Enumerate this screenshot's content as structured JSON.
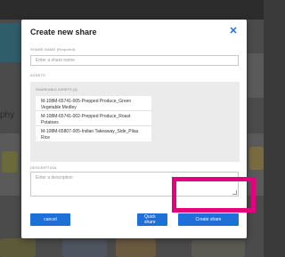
{
  "modal": {
    "title": "Create new share",
    "close_icon": "close-icon",
    "share_name_label": "SHARE NAME (Required)",
    "share_name_placeholder": "Enter a share name",
    "assets_label": "ASSETS",
    "shareable_assets_label": "SHAREABLE ASSETS (3)",
    "assets": [
      {
        "name": "M-108M-65741-005-Prepped Produce_Green Vegetable Medley"
      },
      {
        "name": "M-108M-65741-002-Prepped Produce_Roast Potatoes"
      },
      {
        "name": "M-108M-65807-005-Indian Takeaway_Side_Pilau Rice"
      }
    ],
    "description_label": "DESCRIPTION",
    "description_placeholder": "Enter a description",
    "buttons": {
      "cancel": "cancel",
      "quick_share": "Quick share",
      "create_share": "Create share"
    }
  },
  "background": {
    "left_text": "phy"
  },
  "colors": {
    "accent": "#1f6fd8",
    "highlight": "#e5007e"
  }
}
